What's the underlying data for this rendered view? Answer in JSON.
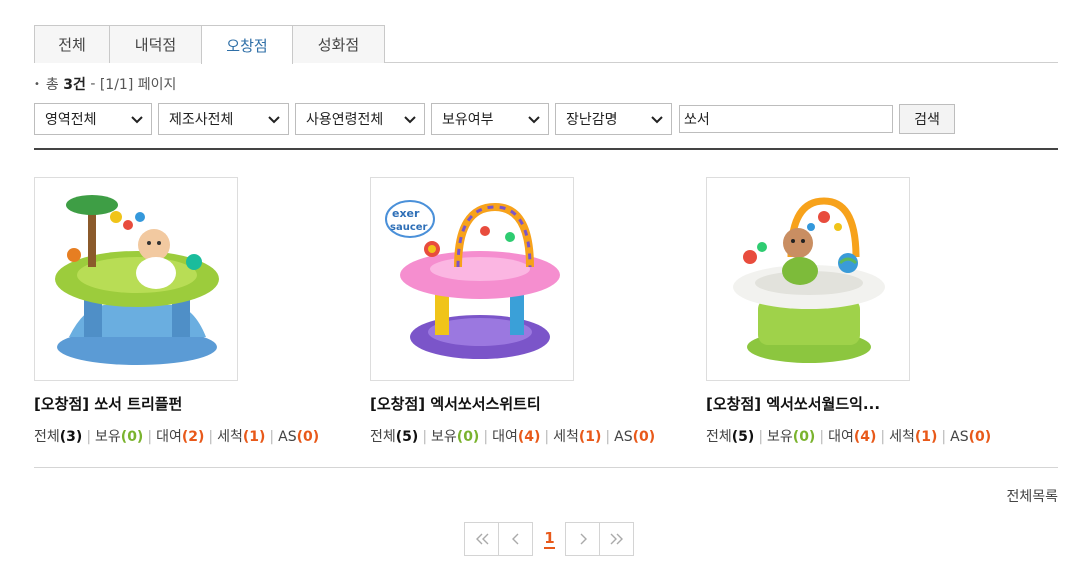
{
  "tabs": [
    {
      "label": "전체",
      "active": false
    },
    {
      "label": "내덕점",
      "active": false
    },
    {
      "label": "오창점",
      "active": true
    },
    {
      "label": "성화점",
      "active": false
    }
  ],
  "summary": {
    "prefix": "총",
    "count": "3건",
    "dash": "-",
    "page_info": "[1/1] 페이지"
  },
  "filters": {
    "area": "영역전체",
    "maker": "제조사전체",
    "age": "사용연령전체",
    "owned": "보유여부",
    "toy": "장난감명",
    "search_value": "쏘서",
    "search_button": "검색"
  },
  "stat_labels": {
    "all": "전체",
    "owned": "보유",
    "rent": "대여",
    "wash": "세척",
    "as": "AS"
  },
  "products": [
    {
      "title": "[오창점] 쏘서 트리플펀",
      "image": "baby-exersaucer-triple-fun-image",
      "all": "(3)",
      "owned": "(0)",
      "rent": "(2)",
      "wash": "(1)",
      "as": "(0)"
    },
    {
      "title": "[오창점] 엑서쏘서스위트티",
      "image": "exersaucer-sweet-tea-image",
      "all": "(5)",
      "owned": "(0)",
      "rent": "(4)",
      "wash": "(1)",
      "as": "(0)"
    },
    {
      "title": "[오창점] 엑서쏘서월드익...",
      "image": "baby-exersaucer-world-image",
      "all": "(5)",
      "owned": "(0)",
      "rent": "(4)",
      "wash": "(1)",
      "as": "(0)"
    }
  ],
  "full_list_label": "전체목록",
  "pagination": {
    "first": "«",
    "prev": "‹",
    "current": "1",
    "next": "›",
    "last": "»"
  },
  "colors": {
    "active_tab": "#2f6fa7",
    "owned_count": "#7ab32e",
    "rent_count": "#e8591a"
  }
}
